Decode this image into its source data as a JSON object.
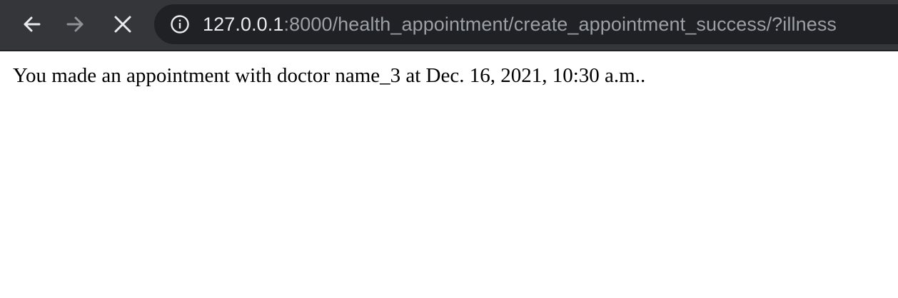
{
  "browser": {
    "url_host": "127.0.0.1",
    "url_rest": ":8000/health_appointment/create_appointment_success/?illness",
    "icons": {
      "back": "back-arrow-icon",
      "forward": "forward-arrow-icon",
      "stop": "close-icon",
      "info": "info-icon"
    },
    "colors": {
      "toolbar": "#35363a",
      "omnibox": "#202124",
      "host_text": "#e8eaed",
      "path_text": "#9aa0a6"
    }
  },
  "page": {
    "message": "You made an appointment with doctor name_3 at Dec. 16, 2021, 10:30 a.m.."
  }
}
